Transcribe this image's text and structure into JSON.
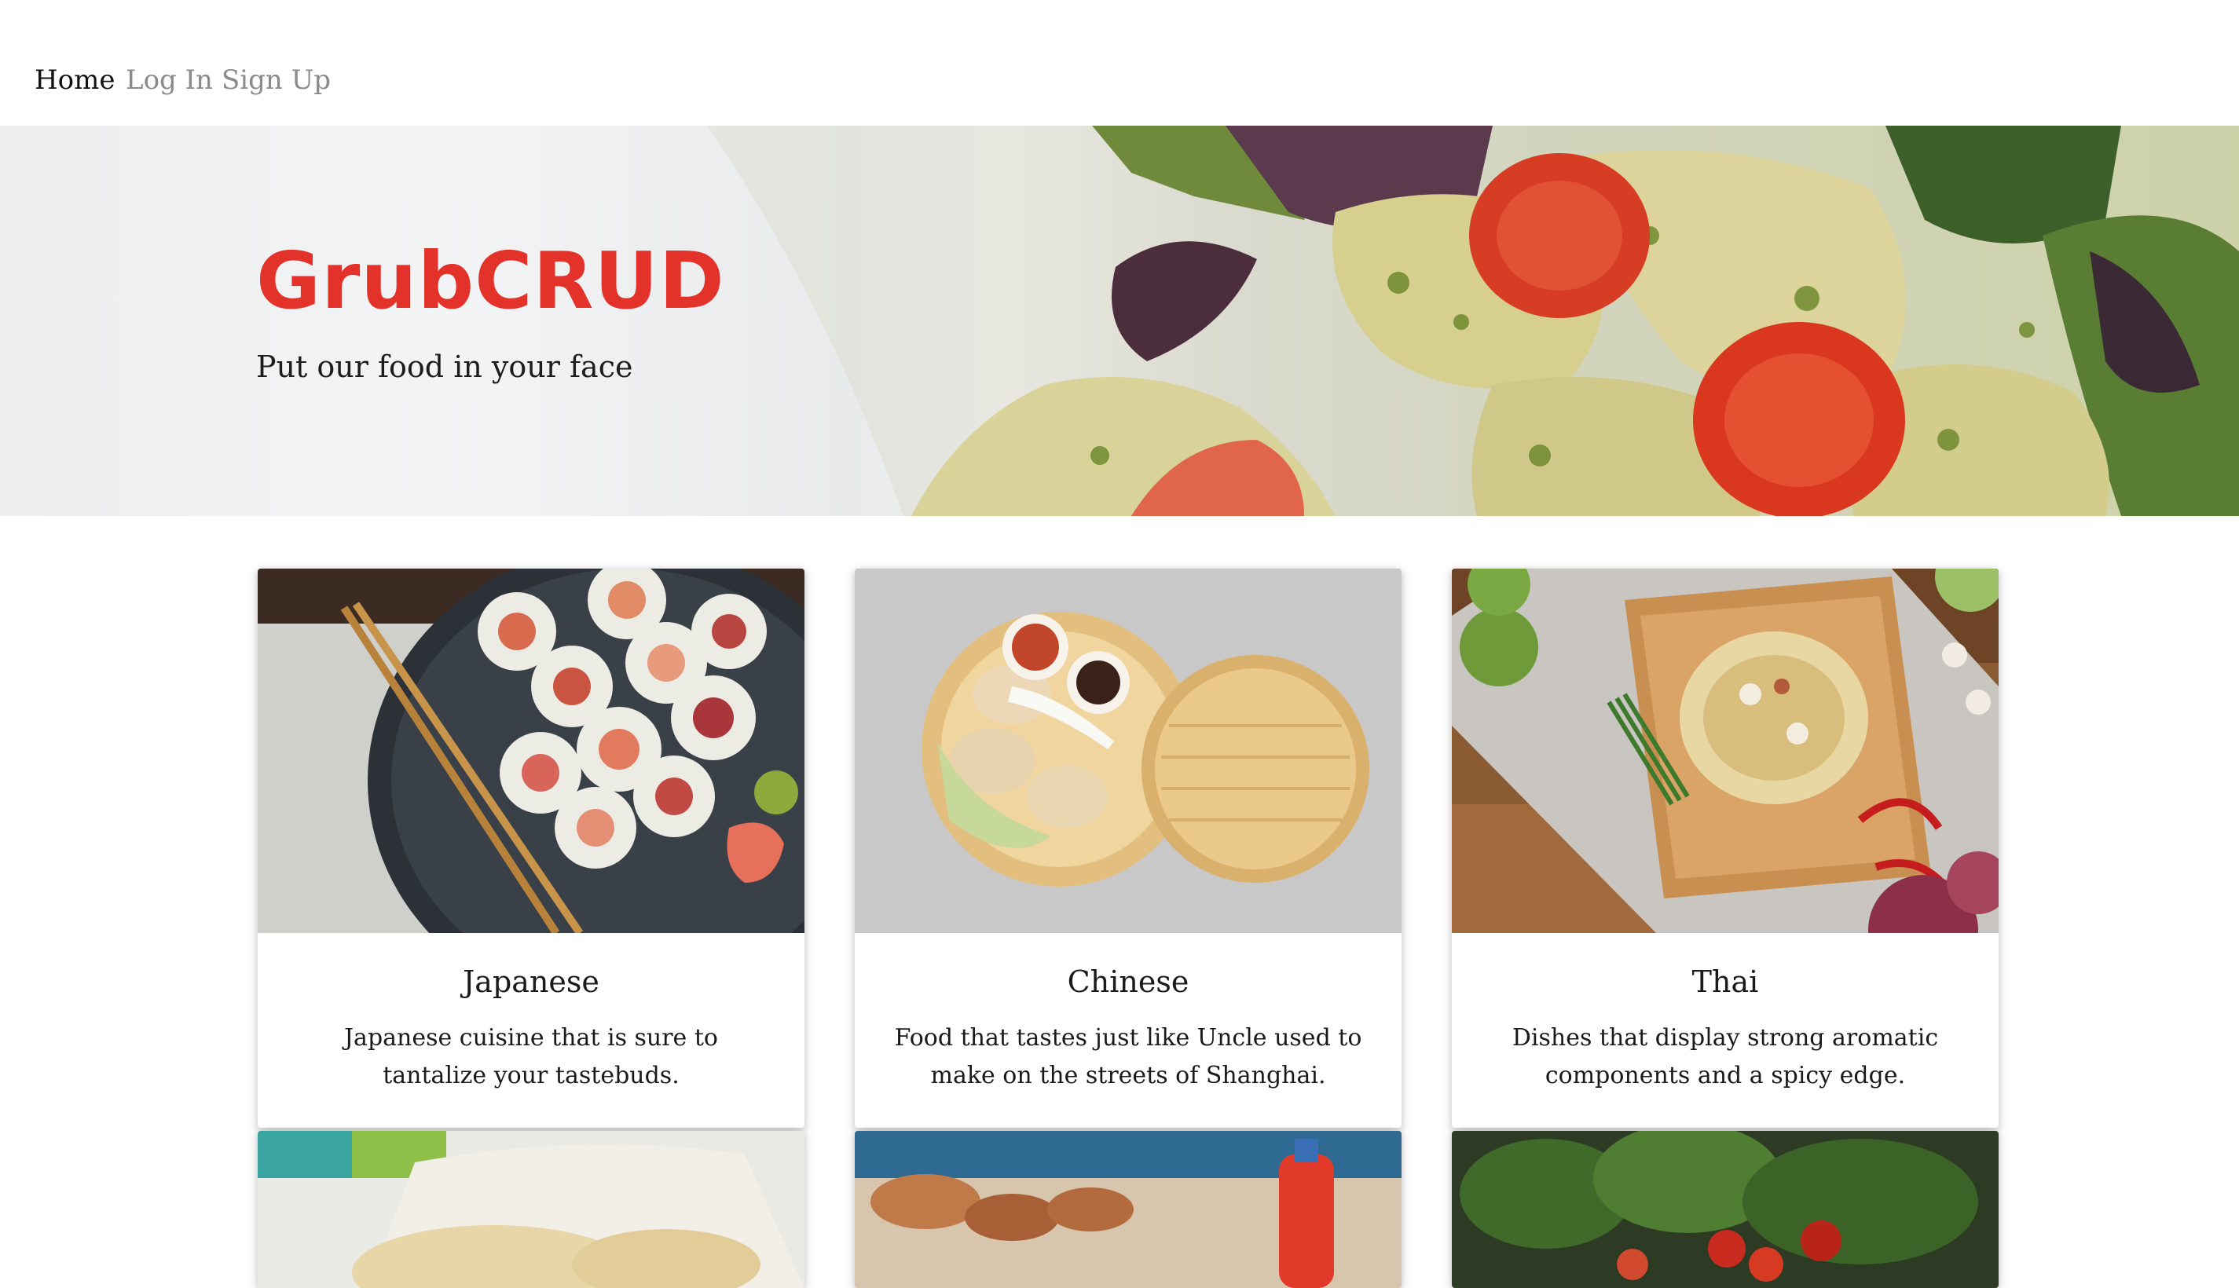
{
  "nav": {
    "home": "Home",
    "login": "Log In",
    "signup": "Sign Up"
  },
  "hero": {
    "title": "GrubCRUD",
    "tagline": "Put our food in your face"
  },
  "colors": {
    "brand": "#e3322a",
    "nav_active": "#111111",
    "nav_inactive": "#8a8a8a"
  },
  "cuisines": [
    {
      "name": "Japanese",
      "description": "Japanese cuisine that is sure to tantalize your tastebuds.",
      "image": "sushi-photo"
    },
    {
      "name": "Chinese",
      "description": "Food that tastes just like Uncle used to make on the streets of Shanghai.",
      "image": "dim-sum-photo"
    },
    {
      "name": "Thai",
      "description": "Dishes that display strong aromatic components and a spicy edge.",
      "image": "pad-thai-photo"
    },
    {
      "image": "flatbread-photo"
    },
    {
      "image": "grill-photo"
    },
    {
      "image": "salad-photo"
    }
  ]
}
